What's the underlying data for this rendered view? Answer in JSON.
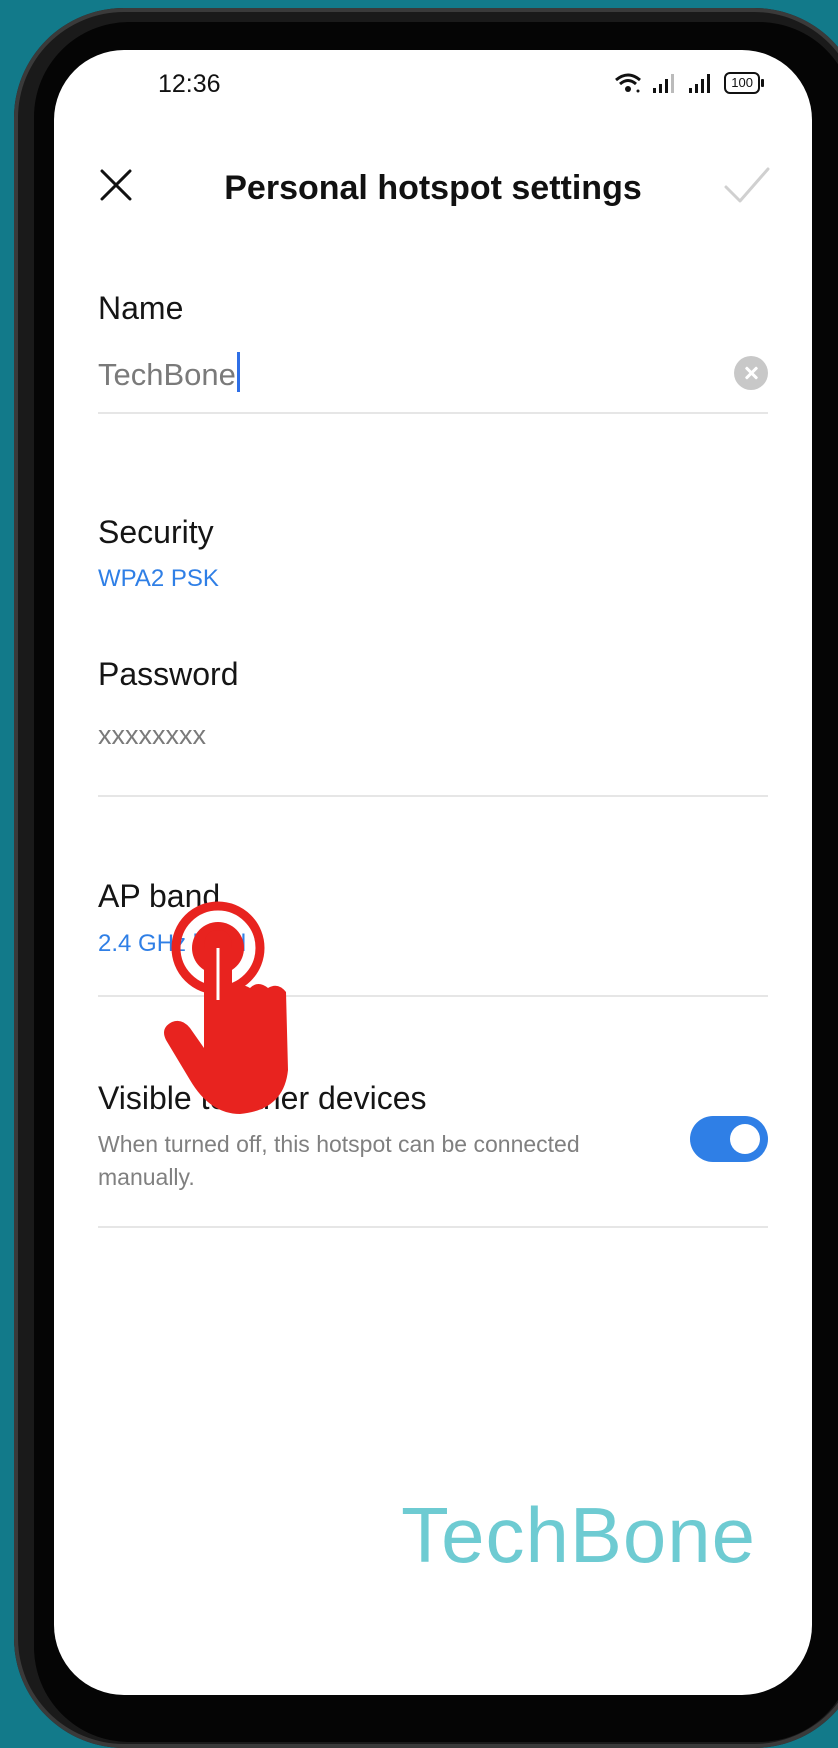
{
  "status_bar": {
    "time": "12:36",
    "battery": "100"
  },
  "header": {
    "title": "Personal hotspot settings"
  },
  "name_field": {
    "label": "Name",
    "value": "TechBone"
  },
  "security": {
    "label": "Security",
    "value": "WPA2 PSK"
  },
  "password": {
    "label": "Password",
    "value": "xxxxxxxx"
  },
  "ap_band": {
    "label": "AP band",
    "value": "2.4 GHz band"
  },
  "visible": {
    "label": "Visible to other devices",
    "description": "When turned off, this hotspot can be connected manually.",
    "enabled": true
  },
  "watermark": "TechBone",
  "colors": {
    "accent": "#2f7fe6",
    "background": "#127a8a",
    "hand": "#e8231f"
  }
}
